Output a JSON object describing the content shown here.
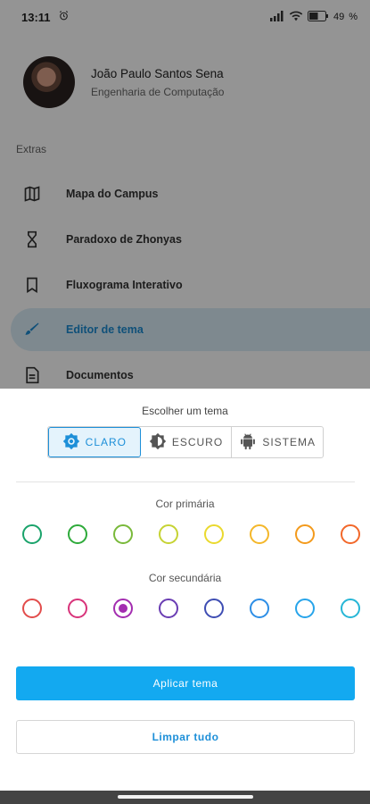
{
  "status_bar": {
    "time": "13:11",
    "battery": "49"
  },
  "drawer": {
    "profile": {
      "name": "João Paulo Santos Sena",
      "course": "Engenharia de Computação"
    },
    "section_label": "Extras",
    "items": [
      {
        "label": "Mapa do Campus",
        "icon": "map-icon"
      },
      {
        "label": "Paradoxo de Zhonyas",
        "icon": "hourglass-icon"
      },
      {
        "label": "Fluxograma Interativo",
        "icon": "bookmark-icon"
      },
      {
        "label": "Editor de tema",
        "icon": "brush-icon",
        "active": true
      },
      {
        "label": "Documentos",
        "icon": "document-icon"
      }
    ]
  },
  "sheet": {
    "title": "Escolher um tema",
    "theme_options": [
      {
        "label": "CLARO",
        "icon": "brightness-icon",
        "selected": true
      },
      {
        "label": "ESCURO",
        "icon": "contrast-icon",
        "selected": false
      },
      {
        "label": "SISTEMA",
        "icon": "android-icon",
        "selected": false
      }
    ],
    "primary_label": "Cor primária",
    "primary_colors": [
      "#1aa36b",
      "#2eaa3a",
      "#79b93a",
      "#c6d334",
      "#ead92e",
      "#f4b72a",
      "#f39a1c",
      "#f2682a"
    ],
    "secondary_label": "Cor secundária",
    "secondary_colors": [
      "#e24c4b",
      "#d8337a",
      "#a32db0",
      "#6a3db3",
      "#3e4db3",
      "#2d8ee6",
      "#27a4ea",
      "#26b6d6"
    ],
    "secondary_selected_index": 2,
    "apply_label": "Aplicar tema",
    "clear_label": "Limpar tudo"
  },
  "colors": {
    "accent": "#13a9f0",
    "accent_text": "#1d8fd8",
    "scrim": "rgba(0,0,0,0.42)"
  }
}
